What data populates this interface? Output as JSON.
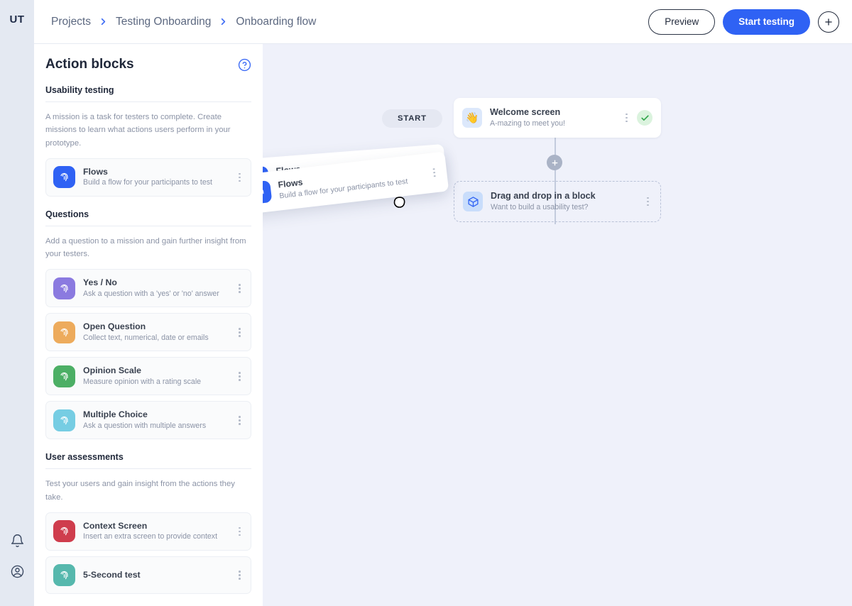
{
  "app": {
    "logo": "UT"
  },
  "rail": {
    "notifications_icon": "bell-icon",
    "account_icon": "user-circle-icon"
  },
  "breadcrumb": {
    "items": [
      {
        "label": "Projects"
      },
      {
        "label": "Testing Onboarding"
      },
      {
        "label": "Onboarding flow"
      }
    ],
    "separator_icon": "chevron-right-icon"
  },
  "toolbar": {
    "preview_label": "Preview",
    "start_testing_label": "Start testing",
    "add_icon": "plus-icon",
    "accent_color": "#2f62f4"
  },
  "sidebar": {
    "title": "Action blocks",
    "help_icon": "question-circle-icon",
    "groups": [
      {
        "title": "Usability testing",
        "description": "A mission is a task for testers to complete. Create missions to learn what actions users perform in your prototype.",
        "blocks": [
          {
            "name": "Flows",
            "description": "Build a flow for your participants to test",
            "icon": "fingerprint-icon",
            "color": "#2f62f4",
            "menu_icon": "kebab-menu-icon"
          }
        ]
      },
      {
        "title": "Questions",
        "description": "Add a question to a mission and gain further insight from your testers.",
        "blocks": [
          {
            "name": "Yes / No",
            "description": "Ask a question with a 'yes' or 'no' answer",
            "icon": "fingerprint-icon",
            "color": "#8b7ae0",
            "menu_icon": "kebab-menu-icon"
          },
          {
            "name": "Open Question",
            "description": "Collect text, numerical, date or emails",
            "icon": "fingerprint-icon",
            "color": "#edab5c",
            "menu_icon": "kebab-menu-icon"
          },
          {
            "name": "Opinion Scale",
            "description": "Measure opinion with a rating scale",
            "icon": "fingerprint-icon",
            "color": "#4caf65",
            "menu_icon": "kebab-menu-icon"
          },
          {
            "name": "Multiple Choice",
            "description": "Ask a question with multiple answers",
            "icon": "fingerprint-icon",
            "color": "#76cde3",
            "menu_icon": "kebab-menu-icon"
          }
        ]
      },
      {
        "title": "User assessments",
        "description": "Test your users and gain insight from the actions they take.",
        "blocks": [
          {
            "name": "Context Screen",
            "description": "Insert an extra screen to provide context",
            "icon": "fingerprint-icon",
            "color": "#cf3d4d",
            "menu_icon": "kebab-menu-icon"
          },
          {
            "name": "5-Second test",
            "description": "",
            "icon": "fingerprint-icon",
            "color": "#56b8ad",
            "menu_icon": "kebab-menu-icon"
          }
        ]
      }
    ]
  },
  "canvas": {
    "start_label": "START",
    "nodes": [
      {
        "name": "Welcome screen",
        "description": "A-mazing to meet you!",
        "icon": "wave-emoji",
        "emoji": "👋",
        "menu_icon": "kebab-menu-icon",
        "status_icon": "check-circle-icon",
        "status_color": "#33a64c"
      }
    ],
    "add_node_icon": "plus-icon",
    "drop_zone": {
      "name": "Drag and drop in a block",
      "description": "Want to build a usability test?",
      "icon": "cube-icon",
      "menu_icon": "kebab-menu-icon"
    },
    "dragging": {
      "name": "Flows",
      "description": "Build a flow for your participants to test",
      "icon": "fingerprint-icon",
      "color": "#2f62f4",
      "menu_icon": "kebab-menu-icon",
      "cursor": "grabbing-hand-cursor"
    }
  }
}
